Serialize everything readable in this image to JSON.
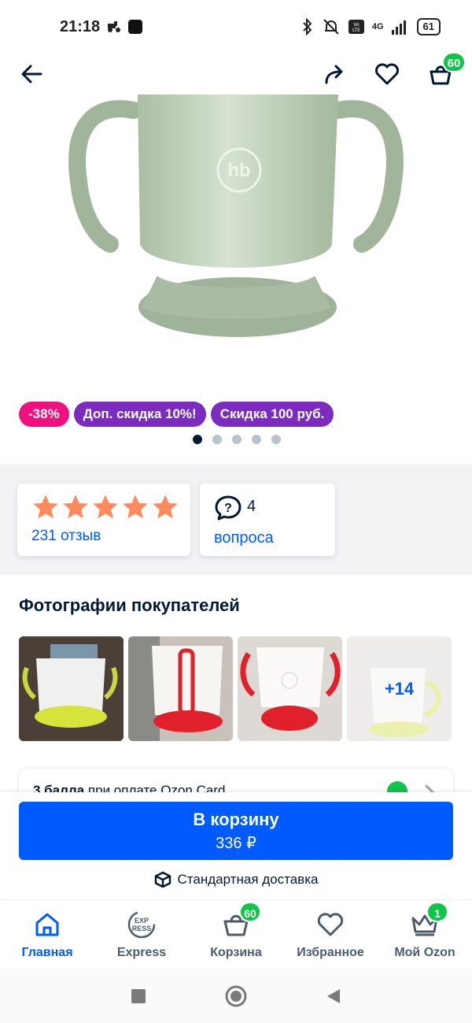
{
  "status_bar": {
    "time": "21:18",
    "network": "4G",
    "battery": "61"
  },
  "header": {
    "cart_count": "60"
  },
  "product": {
    "image_alt_icon": "sippy-cup-image",
    "logo_text": "hb",
    "badges": [
      {
        "label": "-38%",
        "color": "#f1117e"
      },
      {
        "label": "Доп. скидка 10%!",
        "color": "#7b2cbf"
      },
      {
        "label": "Скидка 100 руб.",
        "color": "#7b2cbf"
      }
    ],
    "gallery_dots": 5,
    "gallery_active": 0
  },
  "rating": {
    "stars": 5,
    "reviews_label": "231 отзыв",
    "questions_count": "4",
    "questions_label": "вопроса"
  },
  "photos": {
    "title": "Фотографии покупателей",
    "more_label": "+14"
  },
  "ozon_card": {
    "bold": "3 балла",
    "text": " при оплате Ozon Card"
  },
  "cta": {
    "button_label": "В корзину",
    "price": "336 ₽",
    "delivery_label": "Стандартная доставка"
  },
  "bottom_nav": {
    "items": [
      {
        "label": "Главная",
        "icon": "home-icon",
        "active": true
      },
      {
        "label": "Express",
        "icon": "express-icon",
        "active": false
      },
      {
        "label": "Корзина",
        "icon": "basket-icon",
        "badge": "60",
        "active": false
      },
      {
        "label": "Избранное",
        "icon": "heart-icon",
        "active": false
      },
      {
        "label": "Мой Ozon",
        "icon": "crown-icon",
        "badge": "1",
        "active": false
      }
    ]
  },
  "colors": {
    "accent": "#005bff",
    "badge_green": "#10c44c",
    "discount_pink": "#f1117e",
    "promo_purple": "#7b2cbf",
    "star": "#ff8a5b"
  }
}
